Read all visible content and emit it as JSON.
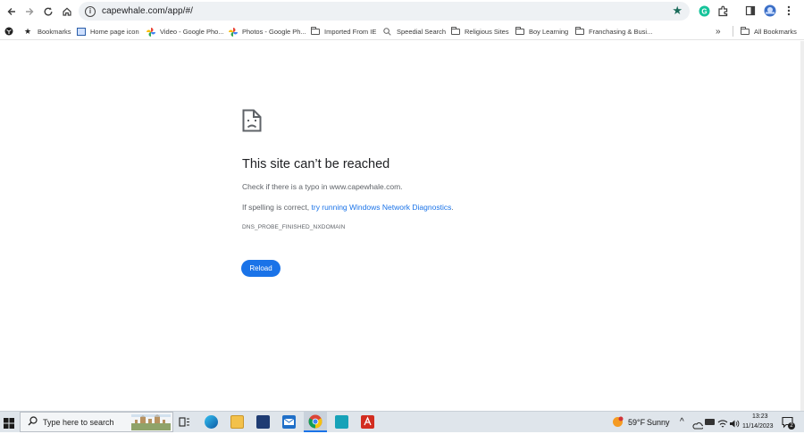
{
  "browser": {
    "url": "capewhale.com/app/#/",
    "bookmarks": [
      {
        "label": "Bookmarks",
        "icon": "star-icon"
      },
      {
        "label": "Home page icon",
        "icon": "favicon-icon"
      },
      {
        "label": "Video - Google Pho...",
        "icon": "google-photos-icon"
      },
      {
        "label": "Photos - Google Ph...",
        "icon": "google-photos-icon"
      },
      {
        "label": "Imported From IE",
        "icon": "folder-icon"
      },
      {
        "label": "Speedial Search",
        "icon": "search-icon"
      },
      {
        "label": "Religious Sites",
        "icon": "folder-icon"
      },
      {
        "label": "Boy Learning",
        "icon": "folder-icon"
      },
      {
        "label": "Franchasing & Busi...",
        "icon": "folder-icon"
      }
    ],
    "overflow": "»",
    "all_bookmarks": "All Bookmarks"
  },
  "error": {
    "title": "This site can’t be reached",
    "line1": "Check if there is a typo in www.capewhale.com.",
    "line2_prefix": "If spelling is correct,",
    "line2_link": "try running Windows Network Diagnostics",
    "line2_suffix": ".",
    "code": "DNS_PROBE_FINISHED_NXDOMAIN",
    "reload_label": "Reload"
  },
  "taskbar": {
    "search_placeholder": "Type here to search",
    "weather_temp": "59°F",
    "weather_desc": "Sunny",
    "time": "13:23",
    "date": "11/14/2023",
    "notification_count": "2"
  },
  "colors": {
    "accent": "#1a73e8",
    "star": "#1a6b5a",
    "taskbar": "#dfe5eb"
  }
}
